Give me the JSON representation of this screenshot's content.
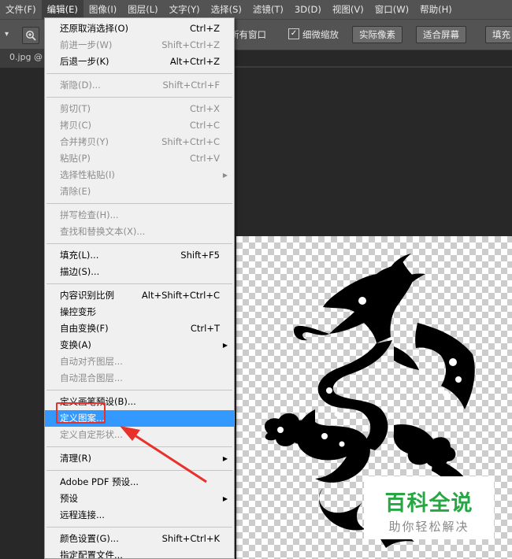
{
  "menubar": {
    "items": [
      "文件(F)",
      "编辑(E)",
      "图像(I)",
      "图层(L)",
      "文字(Y)",
      "选择(S)",
      "滤镜(T)",
      "3D(D)",
      "视图(V)",
      "窗口(W)",
      "帮助(H)"
    ]
  },
  "options_bar": {
    "all_windows_text": "所有窗口",
    "scrubby_zoom_label": "细微缩放",
    "scrubby_zoom_checked": true,
    "actual_pixels_button": "实际像素",
    "fit_screen_button": "适合屏幕",
    "fill_screen_button": "填充"
  },
  "document_tab": {
    "label": "0.jpg @"
  },
  "edit_menu": {
    "groups": [
      [
        {
          "label": "还原取消选择(O)",
          "shortcut": "Ctrl+Z",
          "enabled": true
        },
        {
          "label": "前进一步(W)",
          "shortcut": "Shift+Ctrl+Z",
          "enabled": false
        },
        {
          "label": "后退一步(K)",
          "shortcut": "Alt+Ctrl+Z",
          "enabled": true
        }
      ],
      [
        {
          "label": "渐隐(D)...",
          "shortcut": "Shift+Ctrl+F",
          "enabled": false
        }
      ],
      [
        {
          "label": "剪切(T)",
          "shortcut": "Ctrl+X",
          "enabled": false
        },
        {
          "label": "拷贝(C)",
          "shortcut": "Ctrl+C",
          "enabled": false
        },
        {
          "label": "合并拷贝(Y)",
          "shortcut": "Shift+Ctrl+C",
          "enabled": false
        },
        {
          "label": "粘贴(P)",
          "shortcut": "Ctrl+V",
          "enabled": false
        },
        {
          "label": "选择性粘贴(I)",
          "shortcut": "",
          "enabled": false,
          "submenu": true
        },
        {
          "label": "清除(E)",
          "shortcut": "",
          "enabled": false
        }
      ],
      [
        {
          "label": "拼写检查(H)...",
          "shortcut": "",
          "enabled": false
        },
        {
          "label": "查找和替换文本(X)...",
          "shortcut": "",
          "enabled": false
        }
      ],
      [
        {
          "label": "填充(L)...",
          "shortcut": "Shift+F5",
          "enabled": true
        },
        {
          "label": "描边(S)...",
          "shortcut": "",
          "enabled": true
        }
      ],
      [
        {
          "label": "内容识别比例",
          "shortcut": "Alt+Shift+Ctrl+C",
          "enabled": true
        },
        {
          "label": "操控变形",
          "shortcut": "",
          "enabled": true
        },
        {
          "label": "自由变换(F)",
          "shortcut": "Ctrl+T",
          "enabled": true
        },
        {
          "label": "变换(A)",
          "shortcut": "",
          "enabled": true,
          "submenu": true
        },
        {
          "label": "自动对齐图层...",
          "shortcut": "",
          "enabled": false
        },
        {
          "label": "自动混合图层...",
          "shortcut": "",
          "enabled": false
        }
      ],
      [
        {
          "label": "定义画笔预设(B)...",
          "shortcut": "",
          "enabled": true
        },
        {
          "label": "定义图案...",
          "shortcut": "",
          "enabled": true,
          "highlighted": true
        },
        {
          "label": "定义自定形状...",
          "shortcut": "",
          "enabled": false
        }
      ],
      [
        {
          "label": "清理(R)",
          "shortcut": "",
          "enabled": true,
          "submenu": true
        }
      ],
      [
        {
          "label": "Adobe PDF 预设...",
          "shortcut": "",
          "enabled": true
        },
        {
          "label": "预设",
          "shortcut": "",
          "enabled": true,
          "submenu": true
        },
        {
          "label": "远程连接...",
          "shortcut": "",
          "enabled": true
        }
      ],
      [
        {
          "label": "颜色设置(G)...",
          "shortcut": "Shift+Ctrl+K",
          "enabled": true
        },
        {
          "label": "指定配置文件...",
          "shortcut": "",
          "enabled": true
        }
      ]
    ]
  },
  "watermark": {
    "title": "百科全说",
    "subtitle": "助你轻松解决"
  },
  "colors": {
    "menu_highlight": "#3399ff",
    "annotation_red": "#e8312a",
    "watermark_green": "#27a744"
  }
}
